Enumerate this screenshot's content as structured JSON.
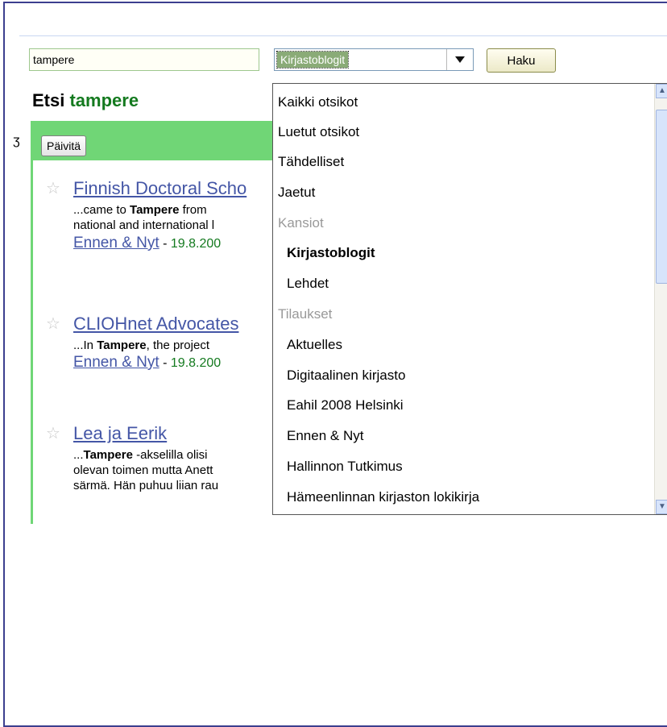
{
  "search": {
    "query": "tampere"
  },
  "selector": {
    "selected": "Kirjastoblogit"
  },
  "haku_button": "Haku",
  "heading": {
    "prefix": "Etsi",
    "term": "tampere"
  },
  "toolbar": {
    "refresh_label": "Päivitä",
    "left_glyph": "ʒ"
  },
  "results": [
    {
      "title": "Finnish Doctoral Scho",
      "snippet1_pre": "...came to ",
      "snippet1_bold": "Tampere",
      "snippet1_post": " from",
      "snippet2": "national and international l",
      "source": "Ennen & Nyt",
      "sep": " - ",
      "date": "19.8.200"
    },
    {
      "title": "CLIOHnet Advocates",
      "snippet1_pre": "...In ",
      "snippet1_bold": "Tampere",
      "snippet1_post": ", the project",
      "source": "Ennen & Nyt",
      "sep": " - ",
      "date": "19.8.200"
    },
    {
      "title": "Lea ja Eerik",
      "snippet1_pre": "...",
      "snippet1_bold": "Tampere",
      "snippet1_post": " -akselilla olisi",
      "snippet2": "olevan toimen mutta Anett",
      "snippet3": "särmä. Hän puhuu liian rau"
    }
  ],
  "dropdown": {
    "options": [
      {
        "label": "Kaikki otsikot",
        "type": "item"
      },
      {
        "label": "Luetut otsikot",
        "type": "item"
      },
      {
        "label": "Tähdelliset",
        "type": "item"
      },
      {
        "label": "Jaetut",
        "type": "item"
      },
      {
        "label": "Kansiot",
        "type": "header"
      },
      {
        "label": "Kirjastoblogit",
        "type": "subitem-selected"
      },
      {
        "label": "Lehdet",
        "type": "subitem"
      },
      {
        "label": "Tilaukset",
        "type": "header"
      },
      {
        "label": "Aktuelles",
        "type": "subitem"
      },
      {
        "label": "Digitaalinen kirjasto",
        "type": "subitem"
      },
      {
        "label": "Eahil 2008 Helsinki",
        "type": "subitem"
      },
      {
        "label": "Ennen & Nyt",
        "type": "subitem"
      },
      {
        "label": "Hallinnon Tutkimus",
        "type": "subitem"
      },
      {
        "label": "Hämeenlinnan kirjaston lokikirja",
        "type": "subitem"
      }
    ]
  },
  "colors": {
    "accent_green": "#70d676",
    "link_blue": "#4456a6",
    "term_green": "#147a1f"
  }
}
